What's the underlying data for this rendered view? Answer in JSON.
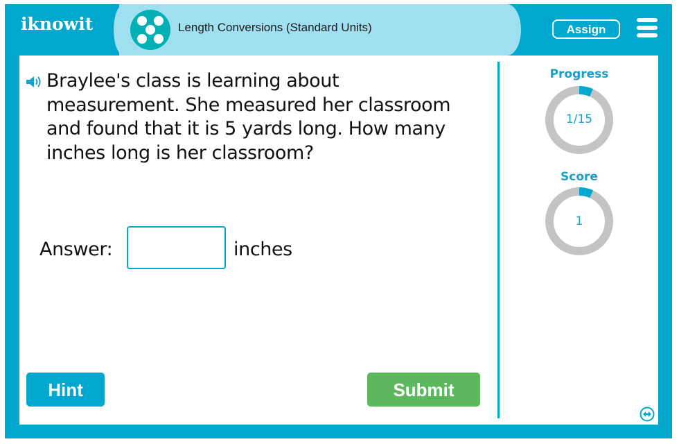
{
  "header": {
    "logo_text": "iknowit",
    "topic_title": "Length Conversions (Standard Units)",
    "assign_label": "Assign",
    "menu_icon": "hamburger-menu-icon",
    "topic_icon": "five-dots-icon"
  },
  "question": {
    "speaker_icon": "speaker-icon",
    "text": "Braylee's class is learning about measurement. She measured her classroom and found that it is 5 yards long. How many inches long is her classroom?"
  },
  "answer": {
    "label": "Answer:",
    "value": "",
    "placeholder": "",
    "unit": "inches"
  },
  "buttons": {
    "hint_label": "Hint",
    "submit_label": "Submit"
  },
  "stats": {
    "progress": {
      "label": "Progress",
      "display": "1/15",
      "current": 1,
      "total": 15
    },
    "score": {
      "label": "Score",
      "display": "1",
      "fraction": 0.067
    }
  },
  "colors": {
    "brand_blue": "#00a8cf",
    "title_bg": "#a0dff0",
    "topic_teal": "#00b0b5",
    "submit_green": "#5cb85c",
    "ring_gray": "#c4c4c4"
  },
  "footer": {
    "expand_icon": "expand-horizontal-icon"
  }
}
